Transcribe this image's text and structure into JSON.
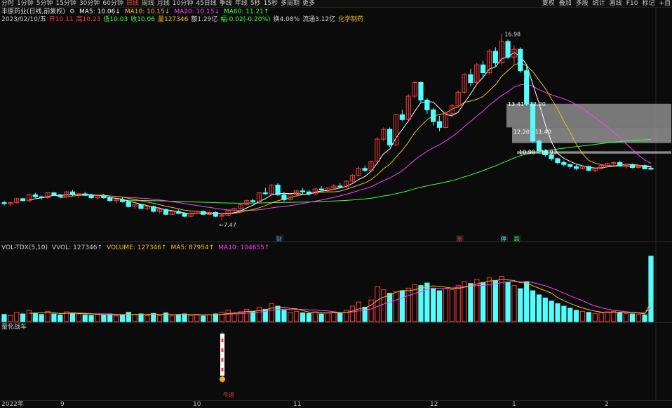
{
  "toolbar": {
    "periods": [
      "分时",
      "1分钟",
      "5分钟",
      "15分钟",
      "30分钟",
      "60分钟",
      "日线",
      "周线",
      "月线",
      "10分钟",
      "45日线",
      "季线",
      "年线",
      "5秒",
      "15秒",
      "多周期",
      "更多"
    ],
    "active_period": "日线",
    "right_items": [
      "复权",
      "叠加",
      "多股",
      "统计",
      "画线",
      "F10",
      "标记",
      "+自"
    ]
  },
  "header": {
    "stock": "丰原药业(日线,前复权)",
    "ma5": "MA5: 10.06↓",
    "ma10": "MA10: 10.15↓",
    "ma20": "MA20: 10.15↓",
    "ma60": "MA60: 11.21↑",
    "date": "2023/02/10/五",
    "open": "开10.11",
    "high": "高10.23",
    "low": "低10.03",
    "close": "收10.06",
    "volume": "量127346",
    "amount": "额1.29亿",
    "change": "幅-0.02(-0.20%)",
    "turnover": "换4.08%",
    "float_cap": "流通3.12亿",
    "sector": "化学制药"
  },
  "colors": {
    "up": "#ff3b3b",
    "down": "#54ffff",
    "ma5": "#ffffff",
    "ma10": "#f0c000",
    "ma20": "#ff40ff",
    "ma60": "#40ff40",
    "bg": "#0b0b0b"
  },
  "price_annotations": {
    "high": "16.98",
    "low": "7.47",
    "zone1": "13.41 - 12.20",
    "zone2": "12.20 - 11.40",
    "zone3": "10.98 - 10.93"
  },
  "event_markers": [
    "财",
    "涨",
    "停",
    "跌"
  ],
  "volume_panel": {
    "title": "VOL-TDX(5,10)",
    "vvol": "VVOL: 127346↑",
    "volume": "VOLUME: 127346↑",
    "ma5": "MA5: 87954↑",
    "ma10": "MA10: 104655↑"
  },
  "bottom_panel": {
    "title": "量化战车",
    "signal": "牛进"
  },
  "x_axis": [
    "2022年",
    "9",
    "10",
    "11",
    "12",
    "1",
    "2"
  ],
  "chart_data": {
    "type": "candlestick",
    "candles": [
      [
        8.35,
        8.45,
        8.2,
        8.3
      ],
      [
        8.3,
        8.4,
        8.15,
        8.35
      ],
      [
        8.35,
        8.6,
        8.3,
        8.55
      ],
      [
        8.55,
        8.6,
        8.4,
        8.45
      ],
      [
        8.45,
        8.8,
        8.4,
        8.75
      ],
      [
        8.75,
        8.85,
        8.6,
        8.65
      ],
      [
        8.65,
        8.7,
        8.5,
        8.6
      ],
      [
        8.6,
        8.9,
        8.55,
        8.85
      ],
      [
        8.85,
        8.9,
        8.7,
        8.75
      ],
      [
        8.75,
        8.8,
        8.6,
        8.65
      ],
      [
        8.65,
        8.95,
        8.6,
        8.9
      ],
      [
        8.9,
        9.0,
        8.7,
        8.75
      ],
      [
        8.75,
        8.85,
        8.6,
        8.8
      ],
      [
        8.8,
        8.9,
        8.7,
        8.72
      ],
      [
        8.72,
        8.8,
        8.55,
        8.6
      ],
      [
        8.6,
        8.75,
        8.5,
        8.7
      ],
      [
        8.7,
        8.8,
        8.55,
        8.6
      ],
      [
        8.6,
        8.7,
        8.4,
        8.45
      ],
      [
        8.45,
        8.55,
        8.3,
        8.5
      ],
      [
        8.5,
        8.6,
        8.35,
        8.4
      ],
      [
        8.4,
        8.45,
        8.1,
        8.15
      ],
      [
        8.15,
        8.3,
        8.05,
        8.25
      ],
      [
        8.25,
        8.3,
        8.0,
        8.05
      ],
      [
        8.05,
        8.2,
        7.95,
        8.15
      ],
      [
        8.15,
        8.2,
        7.85,
        7.9
      ],
      [
        7.9,
        8.05,
        7.8,
        8.0
      ],
      [
        8.0,
        8.05,
        7.7,
        7.75
      ],
      [
        7.75,
        7.95,
        7.7,
        7.9
      ],
      [
        7.9,
        8.0,
        7.75,
        7.8
      ],
      [
        7.8,
        7.85,
        7.6,
        7.65
      ],
      [
        7.65,
        7.85,
        7.6,
        7.8
      ],
      [
        7.8,
        7.95,
        7.75,
        7.9
      ],
      [
        7.9,
        7.95,
        7.7,
        7.75
      ],
      [
        7.75,
        7.9,
        7.7,
        7.85
      ],
      [
        7.85,
        7.9,
        7.6,
        7.65
      ],
      [
        7.65,
        7.8,
        7.47,
        7.7
      ],
      [
        7.7,
        8.0,
        7.65,
        7.95
      ],
      [
        7.95,
        8.1,
        7.9,
        8.05
      ],
      [
        8.05,
        8.3,
        8.0,
        8.25
      ],
      [
        8.25,
        8.5,
        8.2,
        8.45
      ],
      [
        8.45,
        8.55,
        8.3,
        8.4
      ],
      [
        8.4,
        8.9,
        8.35,
        8.85
      ],
      [
        8.85,
        9.1,
        8.75,
        8.8
      ],
      [
        8.8,
        9.3,
        8.75,
        9.25
      ],
      [
        9.25,
        9.35,
        8.7,
        8.75
      ],
      [
        8.75,
        8.9,
        8.4,
        8.5
      ],
      [
        8.5,
        8.8,
        8.45,
        8.75
      ],
      [
        8.75,
        9.0,
        8.7,
        8.95
      ],
      [
        8.95,
        9.1,
        8.8,
        8.9
      ],
      [
        8.9,
        9.0,
        8.7,
        8.8
      ],
      [
        8.8,
        9.1,
        8.75,
        9.05
      ],
      [
        9.05,
        9.2,
        8.95,
        9.0
      ],
      [
        9.0,
        9.15,
        8.9,
        9.1
      ],
      [
        9.1,
        9.3,
        9.0,
        9.2
      ],
      [
        9.2,
        9.35,
        9.1,
        9.15
      ],
      [
        9.15,
        9.5,
        9.1,
        9.45
      ],
      [
        9.45,
        9.8,
        9.4,
        9.75
      ],
      [
        9.75,
        10.2,
        9.7,
        10.1
      ],
      [
        10.1,
        10.25,
        9.9,
        10.0
      ],
      [
        10.0,
        10.5,
        9.95,
        10.45
      ],
      [
        10.45,
        11.7,
        10.4,
        11.6
      ],
      [
        11.6,
        12.2,
        11.5,
        12.1
      ],
      [
        12.1,
        12.2,
        11.2,
        11.3
      ],
      [
        11.3,
        12.9,
        11.25,
        12.85
      ],
      [
        12.85,
        13.1,
        12.5,
        12.6
      ],
      [
        12.6,
        13.9,
        12.55,
        13.8
      ],
      [
        13.8,
        14.6,
        13.7,
        14.5
      ],
      [
        14.5,
        14.55,
        13.5,
        13.6
      ],
      [
        13.6,
        13.7,
        12.9,
        13.1
      ],
      [
        13.1,
        13.2,
        12.3,
        12.5
      ],
      [
        12.5,
        12.8,
        12.0,
        12.2
      ],
      [
        12.2,
        13.0,
        12.15,
        12.9
      ],
      [
        12.9,
        13.4,
        12.7,
        13.3
      ],
      [
        13.3,
        14.1,
        13.2,
        14.0
      ],
      [
        14.0,
        15.0,
        13.9,
        14.9
      ],
      [
        14.9,
        15.2,
        14.3,
        14.5
      ],
      [
        14.5,
        15.5,
        14.4,
        15.4
      ],
      [
        15.4,
        15.6,
        14.8,
        15.0
      ],
      [
        15.0,
        16.2,
        14.9,
        16.1
      ],
      [
        16.1,
        16.3,
        15.3,
        15.5
      ],
      [
        15.5,
        16.98,
        15.4,
        16.6
      ],
      [
        16.6,
        16.7,
        15.7,
        15.8
      ],
      [
        15.8,
        16.4,
        15.4,
        16.2
      ],
      [
        16.2,
        16.3,
        15.0,
        15.1
      ],
      [
        15.1,
        15.4,
        13.3,
        13.4
      ],
      [
        13.4,
        13.5,
        11.4,
        11.5
      ],
      [
        11.5,
        11.6,
        10.9,
        11.0
      ],
      [
        11.0,
        11.1,
        10.7,
        10.8
      ],
      [
        10.8,
        10.9,
        10.5,
        10.6
      ],
      [
        10.6,
        10.65,
        10.3,
        10.4
      ],
      [
        10.4,
        10.5,
        10.2,
        10.3
      ],
      [
        10.3,
        10.35,
        10.1,
        10.2
      ],
      [
        10.2,
        10.3,
        10.0,
        10.1
      ],
      [
        10.1,
        10.25,
        10.05,
        10.2
      ],
      [
        10.2,
        10.25,
        9.95,
        10.0
      ],
      [
        10.0,
        10.15,
        9.9,
        10.1
      ],
      [
        10.1,
        10.3,
        10.05,
        10.25
      ],
      [
        10.25,
        10.4,
        10.15,
        10.35
      ],
      [
        10.35,
        10.45,
        10.25,
        10.4
      ],
      [
        10.4,
        10.5,
        10.2,
        10.25
      ],
      [
        10.25,
        10.35,
        10.1,
        10.3
      ],
      [
        10.3,
        10.35,
        10.1,
        10.15
      ],
      [
        10.15,
        10.3,
        10.1,
        10.25
      ],
      [
        10.25,
        10.3,
        10.05,
        10.08
      ],
      [
        10.11,
        10.23,
        10.03,
        10.06
      ]
    ],
    "volume": [
      14000,
      12000,
      18000,
      15000,
      22000,
      16000,
      14000,
      20000,
      15000,
      13000,
      19000,
      17000,
      15000,
      13000,
      12000,
      14000,
      13000,
      15000,
      11000,
      12000,
      18000,
      13000,
      15000,
      12000,
      16000,
      12000,
      17000,
      11000,
      13000,
      15000,
      12000,
      14000,
      11000,
      13000,
      15000,
      18000,
      22000,
      16000,
      19000,
      24000,
      20000,
      28000,
      24000,
      35000,
      30000,
      22000,
      18000,
      20000,
      17000,
      16000,
      19000,
      15000,
      17000,
      18000,
      16000,
      22000,
      30000,
      38000,
      28000,
      42000,
      68000,
      62000,
      55000,
      58000,
      60000,
      65000,
      72000,
      70000,
      75000,
      65000,
      60000,
      64000,
      62000,
      70000,
      78000,
      74000,
      82000,
      76000,
      85000,
      80000,
      88000,
      76000,
      70000,
      64000,
      78000,
      60000,
      52000,
      46000,
      40000,
      35000,
      30000,
      26000,
      22000,
      20000,
      18000,
      16000,
      17000,
      19000,
      20000,
      18000,
      16000,
      15000,
      14000,
      13000,
      127346
    ],
    "ylim": [
      6.5,
      17.5
    ]
  }
}
